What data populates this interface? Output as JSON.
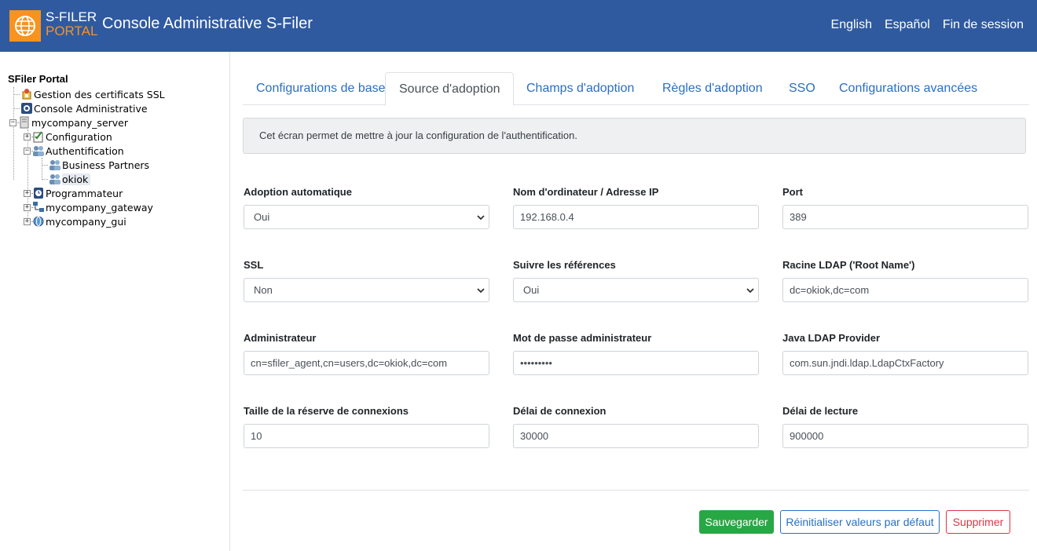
{
  "header": {
    "logo_line1": "S-FILER",
    "logo_line2": "PORTAL",
    "title": "Console Administrative S-Filer",
    "nav": [
      "English",
      "Español",
      "Fin de session"
    ]
  },
  "sidebar": {
    "root": "SFiler Portal",
    "nodes": {
      "ssl": "Gestion des certificats SSL",
      "console": "Console Administrative",
      "server": "mycompany_server",
      "configuration": "Configuration",
      "authentification": "Authentification",
      "business_partners": "Business Partners",
      "okiok": "okiok",
      "programmateur": "Programmateur",
      "gateway": "mycompany_gateway",
      "gui": "mycompany_gui"
    }
  },
  "tabs": [
    "Configurations de base",
    "Source d'adoption",
    "Champs d'adoption",
    "Règles d'adoption",
    "SSO",
    "Configurations avancées"
  ],
  "active_tab": "Source d'adoption",
  "info_text": "Cet écran permet de mettre à jour la configuration de l'authentification.",
  "form": {
    "adoption_auto": {
      "label": "Adoption automatique",
      "value": "Oui"
    },
    "hostname": {
      "label": "Nom d'ordinateur / Adresse IP",
      "value": "192.168.0.4"
    },
    "port": {
      "label": "Port",
      "value": "389"
    },
    "ssl": {
      "label": "SSL",
      "value": "Non"
    },
    "follow_refs": {
      "label": "Suivre les références",
      "value": "Oui"
    },
    "ldap_root": {
      "label": "Racine LDAP ('Root Name')",
      "value": "dc=okiok,dc=com"
    },
    "admin": {
      "label": "Administrateur",
      "value": "cn=sfiler_agent,cn=users,dc=okiok,dc=com"
    },
    "admin_password": {
      "label": "Mot de passe administrateur",
      "value": "•••••••••"
    },
    "java_provider": {
      "label": "Java LDAP Provider",
      "value": "com.sun.jndi.ldap.LdapCtxFactory"
    },
    "pool_size": {
      "label": "Taille de la réserve de connexions",
      "value": "10"
    },
    "connect_timeout": {
      "label": "Délai de connexion",
      "value": "30000"
    },
    "read_timeout": {
      "label": "Délai de lecture",
      "value": "900000"
    }
  },
  "buttons": {
    "save": "Sauvegarder",
    "reset": "Réinitialiser valeurs par défaut",
    "delete": "Supprimer"
  },
  "colors": {
    "header_bg": "#2f5aa0",
    "logo_orange": "#f7931e",
    "link_blue": "#2a6fc0",
    "success": "#28a745",
    "danger": "#dc3545"
  }
}
